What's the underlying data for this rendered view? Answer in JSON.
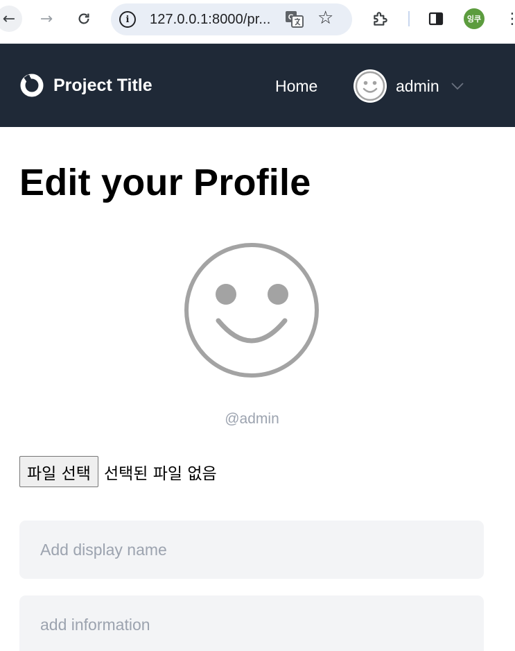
{
  "browser": {
    "url": "127.0.0.1:8000/pr...",
    "profile_initials": "잉쿠"
  },
  "header": {
    "brand": "Project Title",
    "nav_home": "Home",
    "username": "admin"
  },
  "page": {
    "title": "Edit your Profile",
    "handle": "@admin",
    "file_button": "파일 선택",
    "file_status": "선택된 파일 없음",
    "display_name_placeholder": "Add display name",
    "info_placeholder": "add information"
  },
  "colors": {
    "header_bg": "#1f2937",
    "field_bg": "#f3f4f6",
    "placeholder": "#9ca3af",
    "avatar_gray": "#a3a3a3"
  }
}
